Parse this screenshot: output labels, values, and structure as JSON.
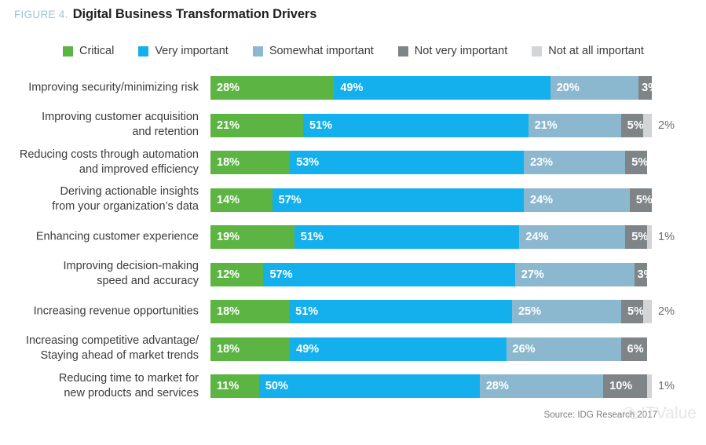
{
  "header": {
    "figure_label": "FIGURE 4.",
    "title": "Digital Business Transformation Drivers",
    "figure_label_color": "#9fc3d4",
    "title_color": "#231f20"
  },
  "footer": {
    "source": "Source: IDG Research 2017",
    "watermark_text": "ITValue",
    "watermark_icon": "wechat-icon"
  },
  "chart_data": {
    "type": "bar",
    "subtype": "stacked-horizontal-100",
    "title": "Digital Business Transformation Drivers",
    "subtitle": "FIGURE 4.",
    "xlabel": "",
    "ylabel": "",
    "xlim": [
      0,
      100
    ],
    "grid": false,
    "legend_position": "top",
    "source": "Source: IDG Research 2017",
    "value_suffix": "%",
    "series": [
      {
        "name": "Critical",
        "color": "#5cb543",
        "values": [
          28,
          21,
          18,
          14,
          19,
          12,
          18,
          18,
          11
        ]
      },
      {
        "name": "Very important",
        "color": "#13b0ed",
        "values": [
          49,
          51,
          53,
          57,
          51,
          57,
          51,
          49,
          50
        ]
      },
      {
        "name": "Somewhat important",
        "color": "#8cb8cf",
        "values": [
          20,
          21,
          23,
          24,
          24,
          27,
          25,
          26,
          28
        ]
      },
      {
        "name": "Not very important",
        "color": "#7f8487",
        "values": [
          3,
          5,
          5,
          5,
          5,
          3,
          5,
          6,
          10
        ]
      },
      {
        "name": "Not at all important",
        "color": "#d2d4d6",
        "values": [
          0,
          2,
          0,
          0,
          1,
          0,
          2,
          0,
          1
        ]
      }
    ],
    "categories": [
      "Improving security/minimizing risk",
      "Improving customer acquisition\nand retention",
      "Reducing costs through automation\nand improved efficiency",
      "Deriving actionable insights\nfrom your organization’s data",
      "Enhancing customer experience",
      "Improving decision-making\nspeed and accuracy",
      "Increasing revenue opportunities",
      "Increasing competitive advantage/\nStaying ahead of market trends",
      "Reducing time to market for\nnew products and services"
    ]
  },
  "legend": {
    "items": [
      {
        "label": "Critical",
        "color": "#5cb543"
      },
      {
        "label": "Very important",
        "color": "#13b0ed"
      },
      {
        "label": "Somewhat important",
        "color": "#8cb8cf"
      },
      {
        "label": "Not very important",
        "color": "#7f8487"
      },
      {
        "label": "Not at all important",
        "color": "#d2d4d6"
      }
    ]
  },
  "rows": [
    {
      "label": "Improving security/minimizing risk",
      "segments": [
        {
          "series": "Critical",
          "value": 28,
          "text": "28%",
          "color": "#5cb543",
          "inside": true
        },
        {
          "series": "Very important",
          "value": 49,
          "text": "49%",
          "color": "#13b0ed",
          "inside": true
        },
        {
          "series": "Somewhat important",
          "value": 20,
          "text": "20%",
          "color": "#8cb8cf",
          "inside": true
        },
        {
          "series": "Not very important",
          "value": 3,
          "text": "3%",
          "color": "#7f8487",
          "inside": true
        }
      ],
      "outside_text": ""
    },
    {
      "label": "Improving customer acquisition\nand retention",
      "segments": [
        {
          "series": "Critical",
          "value": 21,
          "text": "21%",
          "color": "#5cb543",
          "inside": true
        },
        {
          "series": "Very important",
          "value": 51,
          "text": "51%",
          "color": "#13b0ed",
          "inside": true
        },
        {
          "series": "Somewhat important",
          "value": 21,
          "text": "21%",
          "color": "#8cb8cf",
          "inside": true
        },
        {
          "series": "Not very important",
          "value": 5,
          "text": "5%",
          "color": "#7f8487",
          "inside": true
        },
        {
          "series": "Not at all important",
          "value": 2,
          "text": "",
          "color": "#d2d4d6",
          "inside": false
        }
      ],
      "outside_text": "2%"
    },
    {
      "label": "Reducing costs through automation\nand improved efficiency",
      "segments": [
        {
          "series": "Critical",
          "value": 18,
          "text": "18%",
          "color": "#5cb543",
          "inside": true
        },
        {
          "series": "Very important",
          "value": 53,
          "text": "53%",
          "color": "#13b0ed",
          "inside": true
        },
        {
          "series": "Somewhat important",
          "value": 23,
          "text": "23%",
          "color": "#8cb8cf",
          "inside": true
        },
        {
          "series": "Not very important",
          "value": 5,
          "text": "5%",
          "color": "#7f8487",
          "inside": true
        }
      ],
      "outside_text": ""
    },
    {
      "label": "Deriving actionable insights\nfrom your organization’s data",
      "segments": [
        {
          "series": "Critical",
          "value": 14,
          "text": "14%",
          "color": "#5cb543",
          "inside": true
        },
        {
          "series": "Very important",
          "value": 57,
          "text": "57%",
          "color": "#13b0ed",
          "inside": true
        },
        {
          "series": "Somewhat important",
          "value": 24,
          "text": "24%",
          "color": "#8cb8cf",
          "inside": true
        },
        {
          "series": "Not very important",
          "value": 5,
          "text": "5%",
          "color": "#7f8487",
          "inside": true
        }
      ],
      "outside_text": ""
    },
    {
      "label": "Enhancing customer experience",
      "segments": [
        {
          "series": "Critical",
          "value": 19,
          "text": "19%",
          "color": "#5cb543",
          "inside": true
        },
        {
          "series": "Very important",
          "value": 51,
          "text": "51%",
          "color": "#13b0ed",
          "inside": true
        },
        {
          "series": "Somewhat important",
          "value": 24,
          "text": "24%",
          "color": "#8cb8cf",
          "inside": true
        },
        {
          "series": "Not very important",
          "value": 5,
          "text": "5%",
          "color": "#7f8487",
          "inside": true
        },
        {
          "series": "Not at all important",
          "value": 1,
          "text": "",
          "color": "#d2d4d6",
          "inside": false
        }
      ],
      "outside_text": "1%"
    },
    {
      "label": "Improving decision-making\nspeed and accuracy",
      "segments": [
        {
          "series": "Critical",
          "value": 12,
          "text": "12%",
          "color": "#5cb543",
          "inside": true
        },
        {
          "series": "Very important",
          "value": 57,
          "text": "57%",
          "color": "#13b0ed",
          "inside": true
        },
        {
          "series": "Somewhat important",
          "value": 27,
          "text": "27%",
          "color": "#8cb8cf",
          "inside": true
        },
        {
          "series": "Not very important",
          "value": 3,
          "text": "3%",
          "color": "#7f8487",
          "inside": true
        }
      ],
      "outside_text": ""
    },
    {
      "label": "Increasing revenue opportunities",
      "segments": [
        {
          "series": "Critical",
          "value": 18,
          "text": "18%",
          "color": "#5cb543",
          "inside": true
        },
        {
          "series": "Very important",
          "value": 51,
          "text": "51%",
          "color": "#13b0ed",
          "inside": true
        },
        {
          "series": "Somewhat important",
          "value": 25,
          "text": "25%",
          "color": "#8cb8cf",
          "inside": true
        },
        {
          "series": "Not very important",
          "value": 5,
          "text": "5%",
          "color": "#7f8487",
          "inside": true
        },
        {
          "series": "Not at all important",
          "value": 2,
          "text": "",
          "color": "#d2d4d6",
          "inside": false
        }
      ],
      "outside_text": "2%"
    },
    {
      "label": "Increasing competitive advantage/\nStaying ahead of market trends",
      "segments": [
        {
          "series": "Critical",
          "value": 18,
          "text": "18%",
          "color": "#5cb543",
          "inside": true
        },
        {
          "series": "Very important",
          "value": 49,
          "text": "49%",
          "color": "#13b0ed",
          "inside": true
        },
        {
          "series": "Somewhat important",
          "value": 26,
          "text": "26%",
          "color": "#8cb8cf",
          "inside": true
        },
        {
          "series": "Not very important",
          "value": 6,
          "text": "6%",
          "color": "#7f8487",
          "inside": true
        }
      ],
      "outside_text": ""
    },
    {
      "label": "Reducing time to market for\nnew products and services",
      "segments": [
        {
          "series": "Critical",
          "value": 11,
          "text": "11%",
          "color": "#5cb543",
          "inside": true
        },
        {
          "series": "Very important",
          "value": 50,
          "text": "50%",
          "color": "#13b0ed",
          "inside": true
        },
        {
          "series": "Somewhat important",
          "value": 28,
          "text": "28%",
          "color": "#8cb8cf",
          "inside": true
        },
        {
          "series": "Not very important",
          "value": 10,
          "text": "10%",
          "color": "#7f8487",
          "inside": true
        },
        {
          "series": "Not at all important",
          "value": 1,
          "text": "",
          "color": "#d2d4d6",
          "inside": false
        }
      ],
      "outside_text": "1%"
    }
  ]
}
